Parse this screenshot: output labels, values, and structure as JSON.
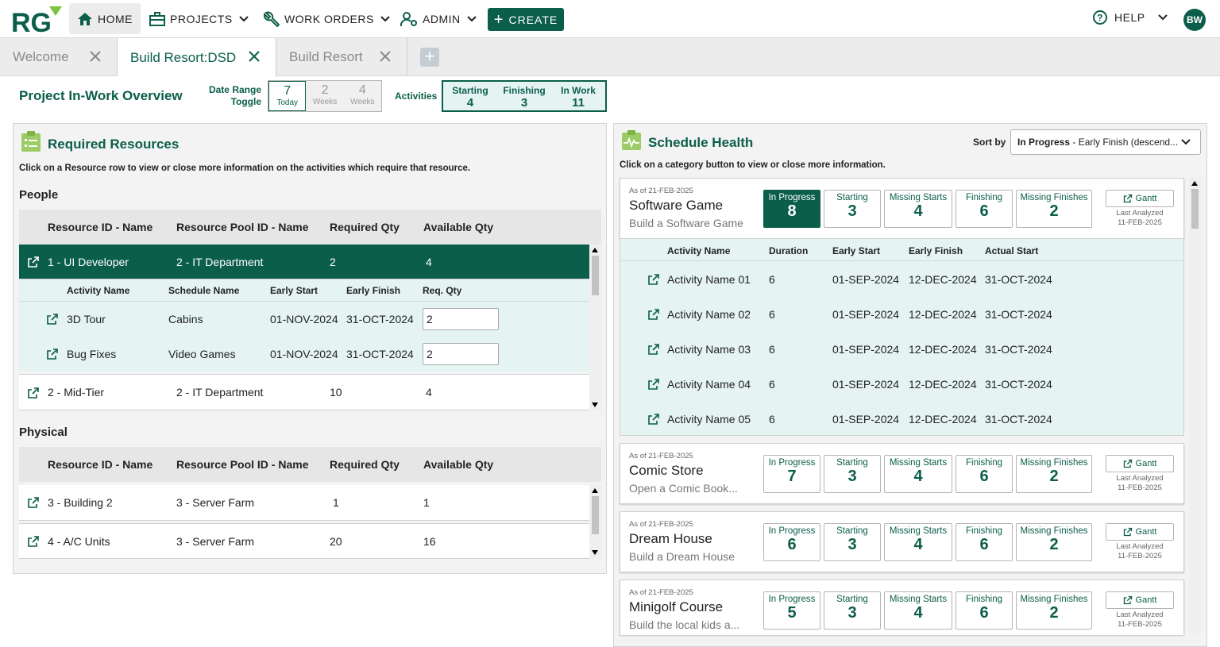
{
  "nav": {
    "logo": "RG",
    "home": "HOME",
    "projects": "PROJECTS",
    "work_orders": "WORK ORDERS",
    "admin": "ADMIN",
    "create": "CREATE",
    "help": "HELP",
    "user_initials": "BW",
    "brand_color": "#0b5e4a"
  },
  "tabs": [
    {
      "label": "Welcome"
    },
    {
      "label": "Build Resort:DSD"
    },
    {
      "label": "Build Resort"
    }
  ],
  "overview": {
    "title": "Project In-Work Overview",
    "date_range_label_1": "Date Range",
    "date_range_label_2": "Toggle",
    "date_options": [
      {
        "num": "7",
        "unit": "Today"
      },
      {
        "num": "2",
        "unit": "Weeks"
      },
      {
        "num": "4",
        "unit": "Weeks"
      }
    ],
    "activities_label": "Activities",
    "activity_counts": [
      {
        "label": "Starting",
        "value": "4"
      },
      {
        "label": "Finishing",
        "value": "3"
      },
      {
        "label": "In Work",
        "value": "11"
      }
    ]
  },
  "resources": {
    "title": "Required Resources",
    "hint": "Click on a Resource row to view or close more information on the activities which require that resource.",
    "columns": [
      "Resource ID - Name",
      "Resource Pool ID - Name",
      "Required Qty",
      "Available Qty"
    ],
    "people_label": "People",
    "people": [
      {
        "id": "1 - UI Developer",
        "pool": "2 - IT Department",
        "req": "2",
        "avail": "4"
      },
      {
        "id": "2 - Mid-Tier",
        "pool": "2 - IT Department",
        "req": "10",
        "avail": "4"
      }
    ],
    "sub_columns": [
      "Activity Name",
      "Schedule Name",
      "Early Start",
      "Early Finish",
      "Req. Qty"
    ],
    "sub_rows": [
      {
        "activity": "3D Tour",
        "schedule": "Cabins",
        "start": "01-NOV-2024",
        "finish": "31-OCT-2024",
        "qty": "2"
      },
      {
        "activity": "Bug Fixes",
        "schedule": "Video Games",
        "start": "01-NOV-2024",
        "finish": "31-OCT-2024",
        "qty": "2"
      }
    ],
    "physical_label": "Physical",
    "physical": [
      {
        "id": "3 - Building 2",
        "pool": "3 - Server Farm",
        "req": "1",
        "avail": "1"
      },
      {
        "id": "4 - A/C Units",
        "pool": "3 - Server Farm",
        "req": "20",
        "avail": "16"
      }
    ]
  },
  "schedule": {
    "title": "Schedule Health",
    "hint": "Click on a category button to view or close more information.",
    "sort_label": "Sort by",
    "sort_value_bold": "In Progress",
    "sort_value_rest": " - Early Finish (descend...",
    "stat_labels": [
      "In Progress",
      "Starting",
      "Missing Starts",
      "Finishing",
      "Missing Finishes"
    ],
    "gantt_label": "Gantt",
    "last_analyzed_label": "Last Analyzed",
    "projects": [
      {
        "asof": "As of 21-FEB-2025",
        "name": "Software Game",
        "desc": "Build a Software Game",
        "stats": [
          "8",
          "3",
          "4",
          "6",
          "2"
        ],
        "analyzed": "11-FEB-2025"
      },
      {
        "asof": "As of 21-FEB-2025",
        "name": "Comic Store",
        "desc": "Open a Comic Book...",
        "stats": [
          "7",
          "3",
          "4",
          "6",
          "2"
        ],
        "analyzed": "11-FEB-2025"
      },
      {
        "asof": "As of 21-FEB-2025",
        "name": "Dream House",
        "desc": "Build a Dream House",
        "stats": [
          "6",
          "3",
          "4",
          "6",
          "2"
        ],
        "analyzed": "11-FEB-2025"
      },
      {
        "asof": "As of 21-FEB-2025",
        "name": "Minigolf Course",
        "desc": "Build the local kids a...",
        "stats": [
          "5",
          "3",
          "4",
          "6",
          "2"
        ],
        "analyzed": "11-FEB-2025"
      }
    ],
    "activity_columns": [
      "Activity Name",
      "Duration",
      "Early Start",
      "Early Finish",
      "Actual Start"
    ],
    "activities": [
      {
        "name": "Activity Name 01",
        "duration": "6",
        "start": "01-SEP-2024",
        "finish": "12-DEC-2024",
        "actual": "31-OCT-2024"
      },
      {
        "name": "Activity Name 02",
        "duration": "6",
        "start": "01-SEP-2024",
        "finish": "12-DEC-2024",
        "actual": "31-OCT-2024"
      },
      {
        "name": "Activity Name 03",
        "duration": "6",
        "start": "01-SEP-2024",
        "finish": "12-DEC-2024",
        "actual": "31-OCT-2024"
      },
      {
        "name": "Activity Name 04",
        "duration": "6",
        "start": "01-SEP-2024",
        "finish": "12-DEC-2024",
        "actual": "31-OCT-2024"
      },
      {
        "name": "Activity Name 05",
        "duration": "6",
        "start": "01-SEP-2024",
        "finish": "12-DEC-2024",
        "actual": "31-OCT-2024"
      }
    ]
  }
}
